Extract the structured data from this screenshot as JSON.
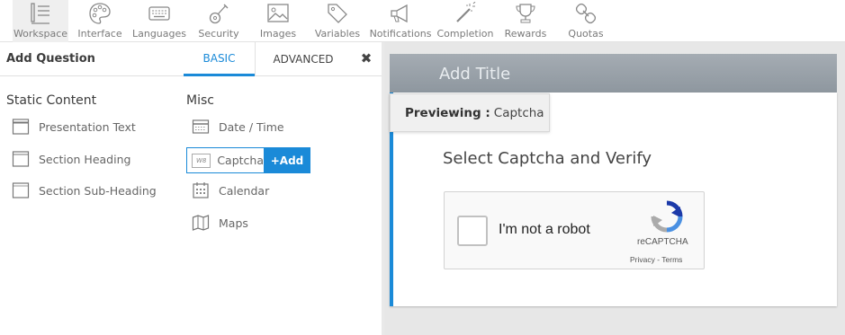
{
  "toolbar": {
    "items": [
      {
        "label": "Workspace",
        "icon": "workspace-icon"
      },
      {
        "label": "Interface",
        "icon": "palette-icon"
      },
      {
        "label": "Languages",
        "icon": "keyboard-icon"
      },
      {
        "label": "Security",
        "icon": "guitar-icon"
      },
      {
        "label": "Images",
        "icon": "image-icon"
      },
      {
        "label": "Variables",
        "icon": "tag-icon"
      },
      {
        "label": "Notifications",
        "icon": "megaphone-icon"
      },
      {
        "label": "Completion",
        "icon": "magic-wand-icon"
      },
      {
        "label": "Rewards",
        "icon": "trophy-icon"
      },
      {
        "label": "Quotas",
        "icon": "link-icon"
      }
    ],
    "active": "Workspace"
  },
  "panel": {
    "title": "Add Question",
    "tabs": {
      "basic": "BASIC",
      "advanced": "ADVANCED"
    },
    "close_symbol": "✖"
  },
  "static_content": {
    "heading": "Static Content",
    "items": [
      "Presentation Text",
      "Section Heading",
      "Section Sub-Heading"
    ]
  },
  "misc": {
    "heading": "Misc",
    "items": [
      "Date / Time",
      "Captcha",
      "Calendar",
      "Maps"
    ],
    "add_label": "+Add",
    "captcha_icon_text": "W8"
  },
  "preview": {
    "title_placeholder": "Add Title",
    "badge_label": "Previewing :",
    "badge_value": "Captcha",
    "question_title": "Select Captcha and Verify",
    "recaptcha": {
      "checkbox_label": "I'm not a robot",
      "brand": "reCAPTCHA",
      "links": "Privacy - Terms"
    }
  },
  "colors": {
    "accent": "#1a8ad8",
    "title_bar": "#9aa2aa"
  }
}
